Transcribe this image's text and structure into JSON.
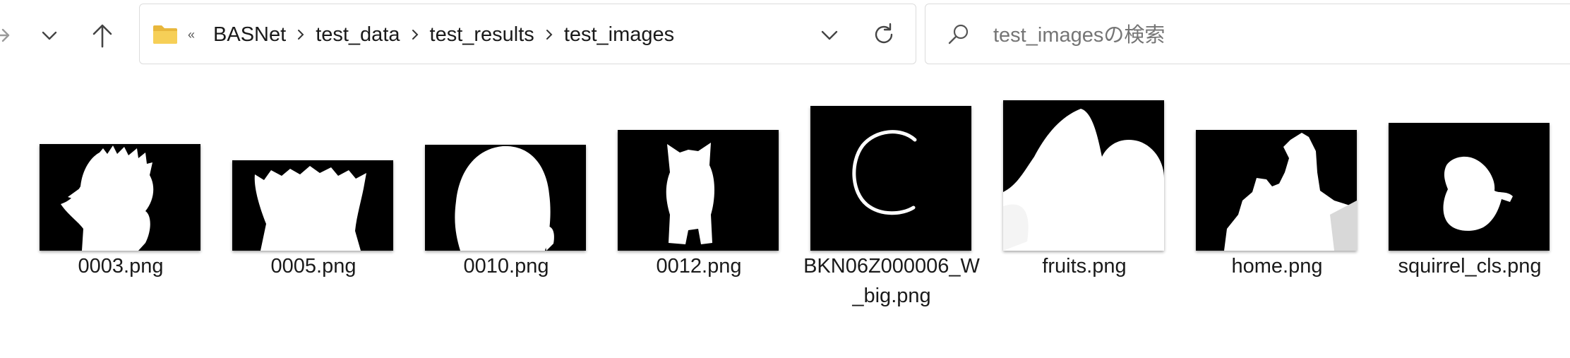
{
  "toolbar": {
    "forward_icon": "arrow-right-icon",
    "recent_icon": "chevron-down-icon",
    "up_icon": "arrow-up-icon"
  },
  "address": {
    "folder_icon": "folder-icon",
    "overflow": "«",
    "crumbs": [
      "BASNet",
      "test_data",
      "test_results",
      "test_images"
    ]
  },
  "search": {
    "placeholder": "test_imagesの検索"
  },
  "files": [
    {
      "name": "0003.png"
    },
    {
      "name": "0005.png"
    },
    {
      "name": "0010.png"
    },
    {
      "name": "0012.png"
    },
    {
      "name": "BKN06Z000006_W_big.png"
    },
    {
      "name": "fruits.png"
    },
    {
      "name": "home.png"
    },
    {
      "name": "squirrel_cls.png"
    }
  ]
}
